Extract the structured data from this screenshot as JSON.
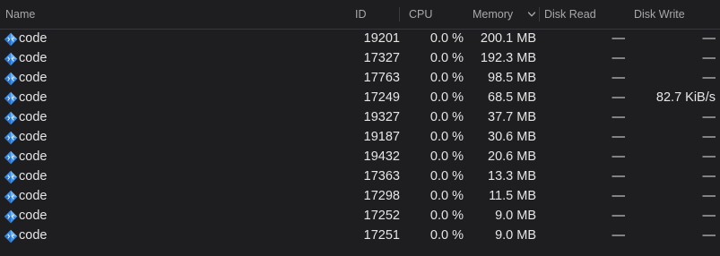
{
  "columns": {
    "name": "Name",
    "id": "ID",
    "cpu": "CPU",
    "memory": "Memory",
    "disk_read": "Disk Read",
    "disk_write": "Disk Write"
  },
  "sort": {
    "column": "Memory",
    "direction": "descending",
    "icon": "chevron-down-icon"
  },
  "app_icon": "vscode-diamond-icon",
  "colors": {
    "background": "#1e1e20",
    "icon_blue": "#3b8ee8"
  },
  "rows": [
    {
      "name": "code",
      "id": "19201",
      "cpu": "0.0 %",
      "memory": "200.1 MB",
      "disk_read": "—",
      "disk_write": "—"
    },
    {
      "name": "code",
      "id": "17327",
      "cpu": "0.0 %",
      "memory": "192.3 MB",
      "disk_read": "—",
      "disk_write": "—"
    },
    {
      "name": "code",
      "id": "17763",
      "cpu": "0.0 %",
      "memory": "98.5 MB",
      "disk_read": "—",
      "disk_write": "—"
    },
    {
      "name": "code",
      "id": "17249",
      "cpu": "0.0 %",
      "memory": "68.5 MB",
      "disk_read": "—",
      "disk_write": "82.7 KiB/s"
    },
    {
      "name": "code",
      "id": "19327",
      "cpu": "0.0 %",
      "memory": "37.7 MB",
      "disk_read": "—",
      "disk_write": "—"
    },
    {
      "name": "code",
      "id": "19187",
      "cpu": "0.0 %",
      "memory": "30.6 MB",
      "disk_read": "—",
      "disk_write": "—"
    },
    {
      "name": "code",
      "id": "19432",
      "cpu": "0.0 %",
      "memory": "20.6 MB",
      "disk_read": "—",
      "disk_write": "—"
    },
    {
      "name": "code",
      "id": "17363",
      "cpu": "0.0 %",
      "memory": "13.3 MB",
      "disk_read": "—",
      "disk_write": "—"
    },
    {
      "name": "code",
      "id": "17298",
      "cpu": "0.0 %",
      "memory": "11.5 MB",
      "disk_read": "—",
      "disk_write": "—"
    },
    {
      "name": "code",
      "id": "17252",
      "cpu": "0.0 %",
      "memory": "9.0 MB",
      "disk_read": "—",
      "disk_write": "—"
    },
    {
      "name": "code",
      "id": "17251",
      "cpu": "0.0 %",
      "memory": "9.0 MB",
      "disk_read": "—",
      "disk_write": "—"
    }
  ]
}
